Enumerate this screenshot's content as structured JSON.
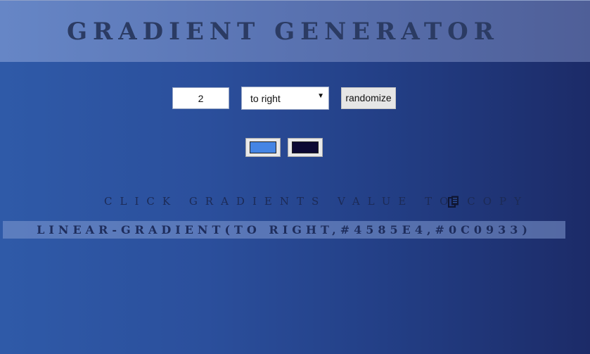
{
  "header": {
    "title": "GRADIENT GENERATOR"
  },
  "controls": {
    "count_value": "2",
    "direction_selected": "to right",
    "randomize_label": "randomize"
  },
  "swatches": [
    {
      "color": "#4585E4"
    },
    {
      "color": "#0C0933"
    }
  ],
  "copy_hint": "CLICK GRADIENTS VALUE TO COPY",
  "copy_icon": "clipboard-icon",
  "gradient_value": "LINEAR-GRADIENT(TO RIGHT,#4585E4,#0C0933)"
}
